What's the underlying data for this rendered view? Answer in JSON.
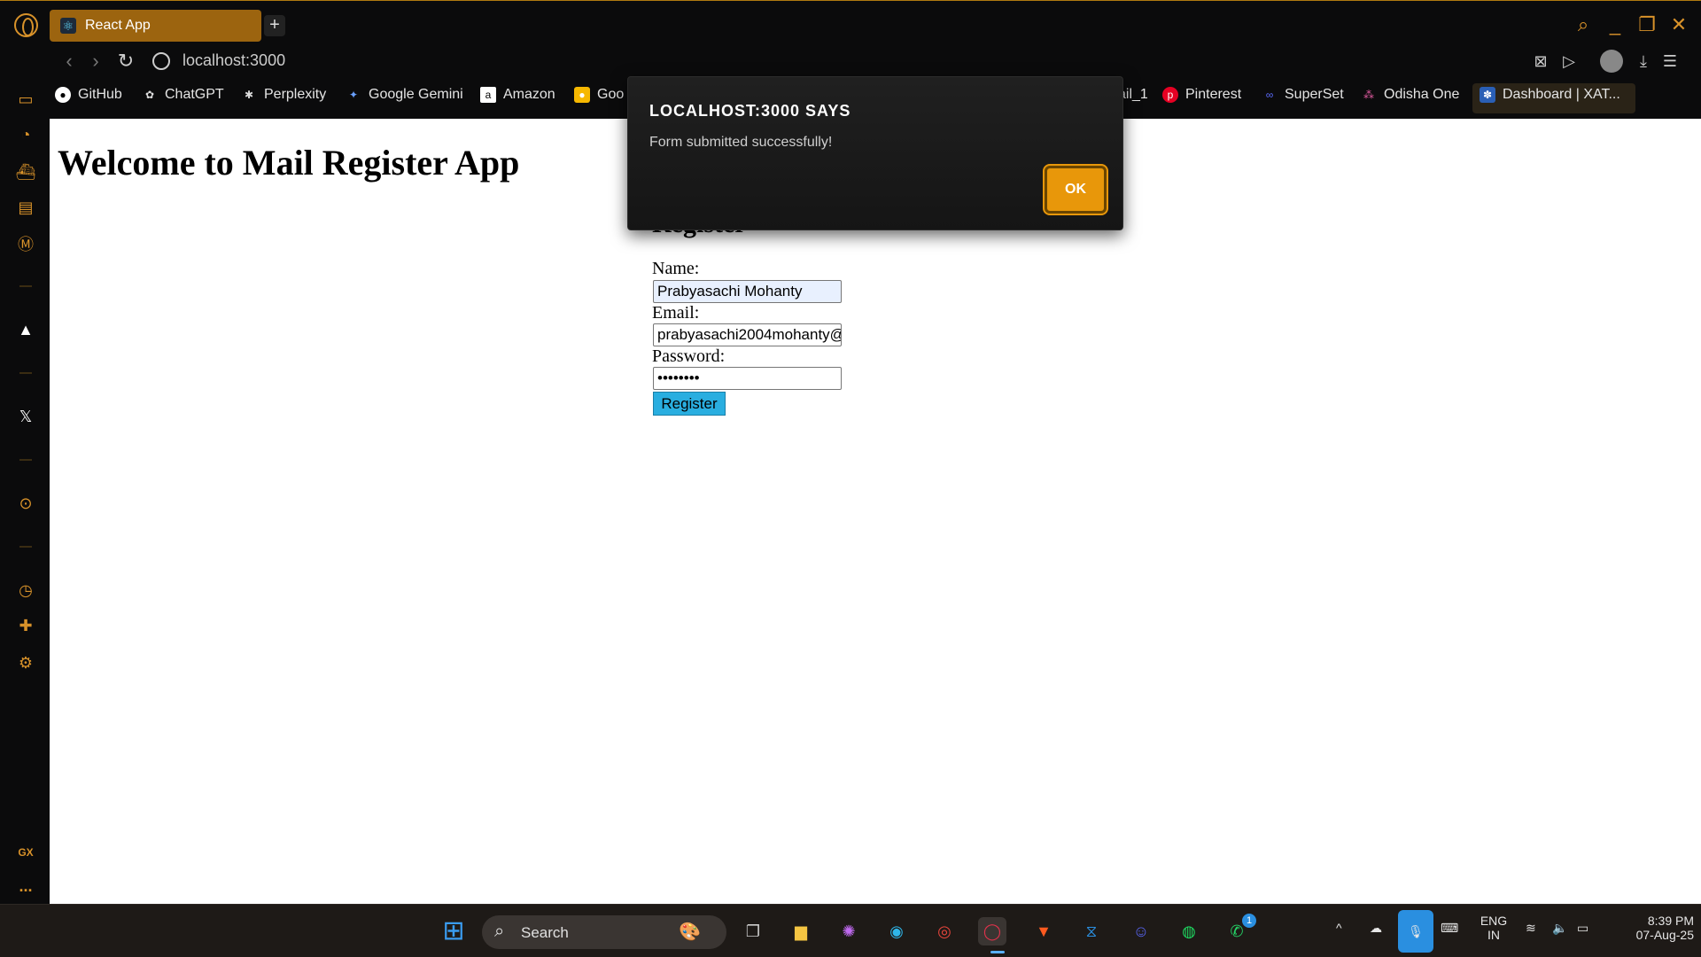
{
  "browser": {
    "tab_title": "React App",
    "new_tab": "+",
    "url": "localhost:3000"
  },
  "bookmarks": [
    {
      "label": "GitHub",
      "icon": "github-icon"
    },
    {
      "label": "ChatGPT",
      "icon": "chatgpt-icon"
    },
    {
      "label": "Perplexity",
      "icon": "perplexity-icon"
    },
    {
      "label": "Google Gemini",
      "icon": "gemini-icon"
    },
    {
      "label": "Amazon",
      "icon": "amazon-icon"
    },
    {
      "label": "Goo",
      "icon": "google-keep-icon"
    },
    {
      "label": "ail_1",
      "icon": "mail-icon"
    },
    {
      "label": "Pinterest",
      "icon": "pinterest-icon"
    },
    {
      "label": "SuperSet",
      "icon": "superset-icon"
    },
    {
      "label": "Odisha One",
      "icon": "odisha-one-icon"
    },
    {
      "label": "Dashboard | XAT...",
      "icon": "dashboard-icon"
    }
  ],
  "page": {
    "heading": "Welcome to Mail Register App",
    "form_heading": "Register",
    "name_label": "Name:",
    "name_value": "Prabyasachi Mohanty",
    "email_label": "Email:",
    "email_value": "prabyasachi2004mohanty@",
    "password_label": "Password:",
    "password_value": "••••••••",
    "register_button": "Register"
  },
  "alert": {
    "title": "LOCALHOST:3000 SAYS",
    "message": "Form submitted successfully!",
    "ok_label": "OK"
  },
  "sidebar": {
    "gx_label": "GX",
    "more_label": "..."
  },
  "taskbar": {
    "search_label": "Search",
    "language": "ENG",
    "region": "IN",
    "time": "8:39 PM",
    "date": "07-Aug-25",
    "whatsapp_badge": "1"
  },
  "colors": {
    "accent": "#d8922a",
    "active_tab": "#9c640f",
    "ok_button": "#e8970a",
    "register_button": "#29aee0"
  }
}
